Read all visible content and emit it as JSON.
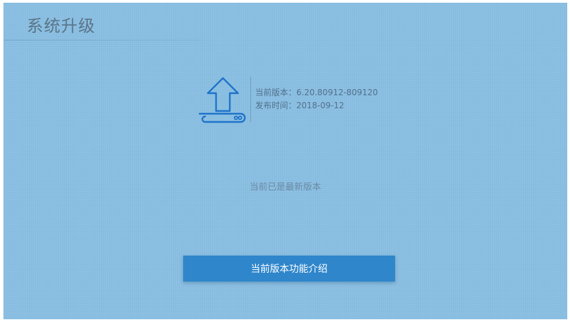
{
  "header": {
    "title": "系统升级"
  },
  "version_info": {
    "current_version_label": "当前版本：",
    "current_version": "6.20.80912-809120",
    "release_time_label": "发布时间：",
    "release_time": "2018-09-12"
  },
  "status": {
    "message": "当前已是最新版本"
  },
  "actions": {
    "feature_intro_label": "当前版本功能介绍"
  },
  "icons": {
    "upgrade": "upload-arrow-device-icon"
  },
  "colors": {
    "background": "#86bce0",
    "accent": "#2f86cb",
    "icon": "#1f73c9"
  }
}
